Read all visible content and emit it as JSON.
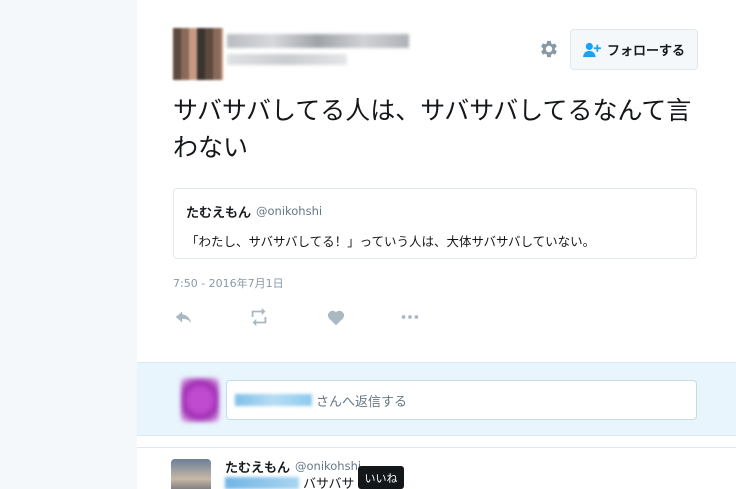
{
  "header": {
    "gear_icon": "gear-icon",
    "follow_label": "フォローする"
  },
  "tweet": {
    "text": "サバサバしてる人は、サバサバしてるなんて言わない",
    "timestamp": "7:50 - 2016年7月1日"
  },
  "quote": {
    "name": "たむえもん",
    "handle": "@onikohshi",
    "text": "「わたし、サバサバしてる！」っていう人は、大体サバサバしていない。"
  },
  "actions": {
    "reply_icon": "reply-icon",
    "retweet_icon": "retweet-icon",
    "like_icon": "heart-icon",
    "more_icon": "more-icon"
  },
  "reply_box": {
    "placeholder_suffix": "さんへ返信する"
  },
  "next_tweet": {
    "name": "たむえもん",
    "handle": "@onikohshi",
    "text": "バサバサ"
  },
  "tooltip": {
    "label": "いいね"
  }
}
